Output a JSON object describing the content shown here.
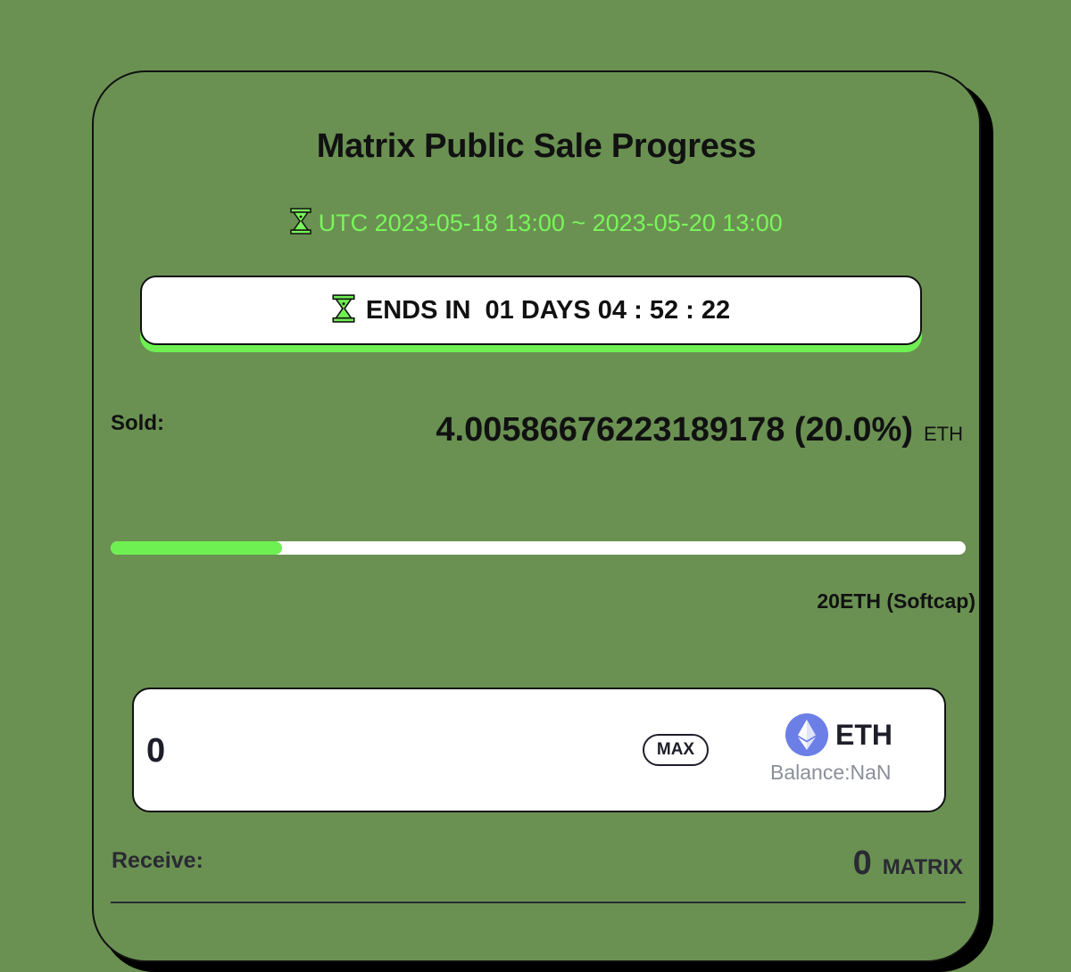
{
  "sale": {
    "title": "Matrix Public Sale Progress",
    "dates": "UTC 2023-05-18 13:00 ~ 2023-05-20 13:00",
    "countdown_label": "ENDS IN",
    "countdown_value": "01 DAYS 04 : 52 : 22"
  },
  "sold": {
    "label": "Sold:",
    "amount": "4.00586676223189178 (20.0%)",
    "unit": "ETH",
    "progress_fraction": 0.2
  },
  "softcap": "20ETH (Softcap)",
  "purchase": {
    "amount_value": "0",
    "max_label": "MAX",
    "token": "ETH",
    "balance": "Balance:NaN"
  },
  "receive": {
    "label": "Receive:",
    "amount": "0",
    "unit": "MATRIX"
  },
  "colors": {
    "background": "#6a9152",
    "accent": "#6ef052",
    "date_text": "#7af55b",
    "eth_logo": "#6b7fe6"
  },
  "icons": {
    "hourglass": "hourglass-icon",
    "eth": "eth-logo-icon"
  }
}
